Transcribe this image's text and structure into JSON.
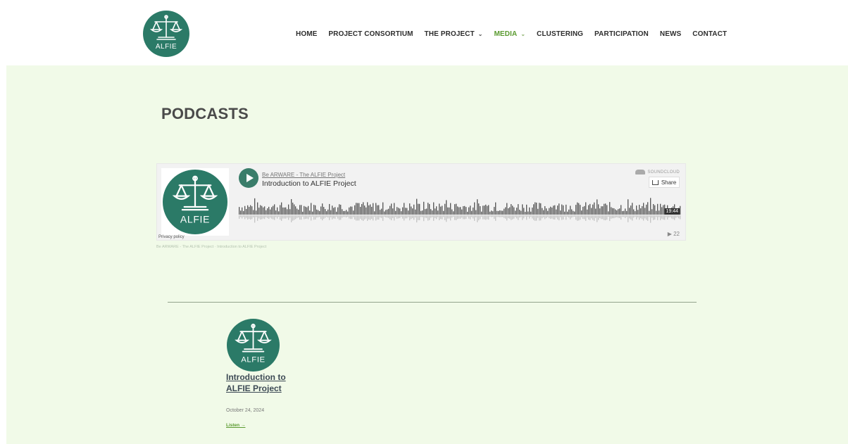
{
  "header": {
    "logo_text": "ALFIE",
    "nav": [
      {
        "label": "HOME",
        "dropdown": false,
        "active": false
      },
      {
        "label": "PROJECT CONSORTIUM",
        "dropdown": false,
        "active": false
      },
      {
        "label": "THE PROJECT",
        "dropdown": true,
        "active": false
      },
      {
        "label": "MEDIA",
        "dropdown": true,
        "active": true
      },
      {
        "label": "CLUSTERING",
        "dropdown": false,
        "active": false
      },
      {
        "label": "PARTICIPATION",
        "dropdown": false,
        "active": false
      },
      {
        "label": "NEWS",
        "dropdown": false,
        "active": false
      },
      {
        "label": "CONTACT",
        "dropdown": false,
        "active": false
      }
    ]
  },
  "main": {
    "title": "PODCASTS",
    "player": {
      "artwork_text": "ALFIE",
      "user": "Be ARWARE - The ALFIE Project",
      "track": "Introduction to ALFIE Project",
      "brand": "SOUNDCLOUD",
      "share_label": "Share",
      "duration": "19:44",
      "plays": "▶ 22",
      "privacy": "Privacy policy",
      "caption": "Be ARWARE - The ALFIE Project · Introduction to ALFIE Project"
    },
    "post": {
      "thumb_text": "ALFIE",
      "title": "Introduction to ALFIE Project",
      "date": "October 24, 2024",
      "listen": "Listen →"
    }
  },
  "colors": {
    "brand_teal": "#2b7a67",
    "accent_green": "#5a9a2f",
    "page_bg": "#f1fae8"
  }
}
